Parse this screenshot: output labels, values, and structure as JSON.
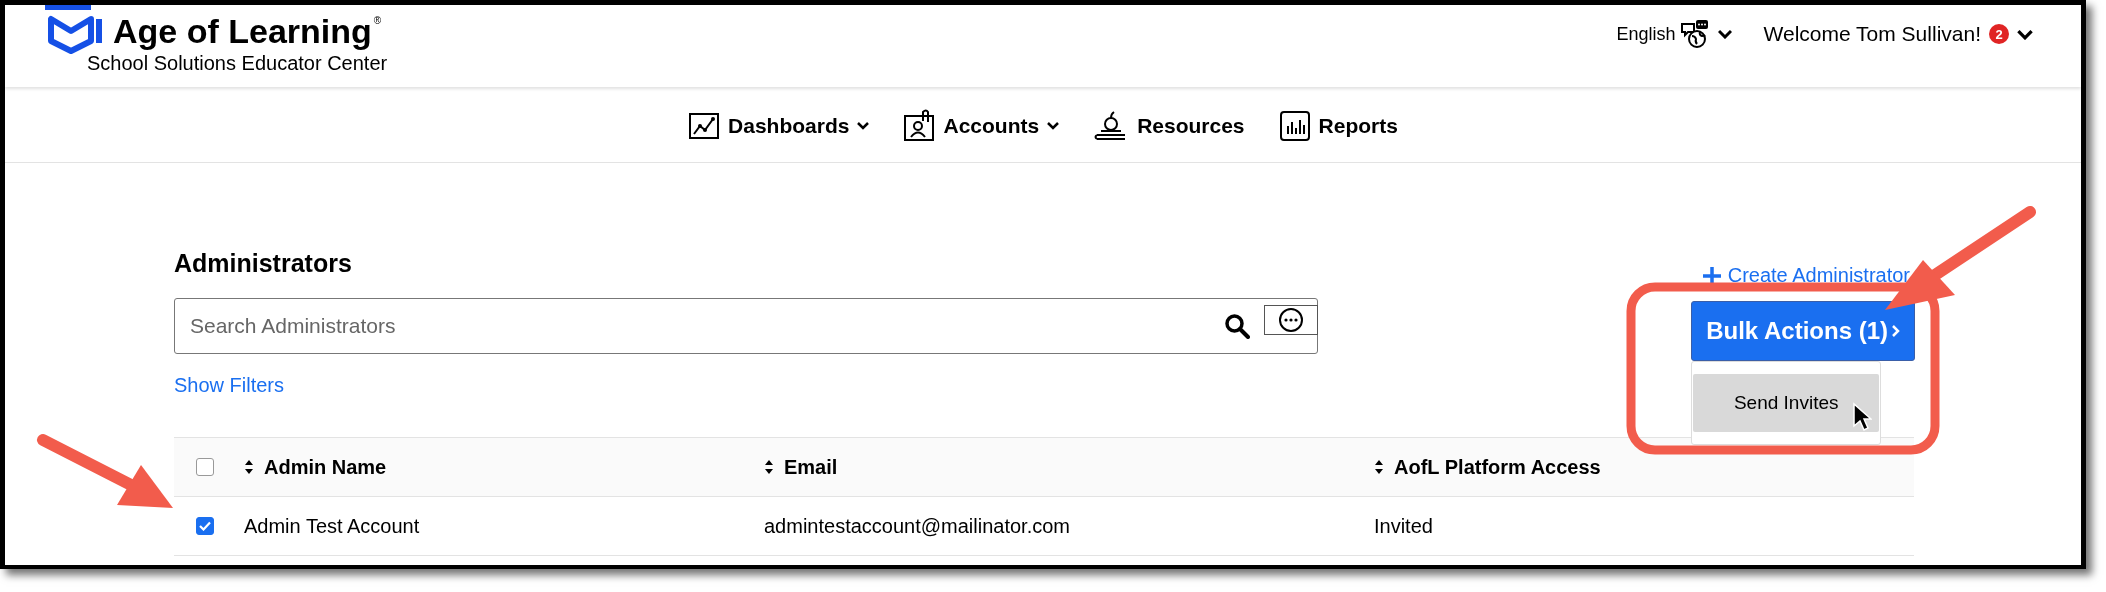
{
  "header": {
    "brand": "Age of Learning",
    "registered": "®",
    "subtitle": "School Solutions Educator Center",
    "language": "English",
    "welcome": "Welcome Tom Sullivan!",
    "notification_count": "2"
  },
  "nav": [
    {
      "label": "Dashboards",
      "kind": "chart",
      "dropdown": true
    },
    {
      "label": "Accounts",
      "kind": "badge",
      "dropdown": true
    },
    {
      "label": "Resources",
      "kind": "book",
      "dropdown": false
    },
    {
      "label": "Reports",
      "kind": "bars",
      "dropdown": false
    }
  ],
  "page": {
    "title": "Administrators",
    "search_placeholder": "Search Administrators",
    "filters_link": "Show Filters",
    "create_link": "Create Administrator"
  },
  "bulk_actions": {
    "label": "Bulk Actions (1)",
    "expanded": true,
    "menu": [
      {
        "label": "Send Invites",
        "hovered": true
      }
    ]
  },
  "table": {
    "all_checked": false,
    "columns": [
      {
        "label": "Admin Name"
      },
      {
        "label": "Email"
      },
      {
        "label": "AofL Platform Access"
      }
    ],
    "rows": [
      {
        "checked": true,
        "cells": [
          "Admin Test Account",
          "admintestaccount@mailinator.com",
          "Invited"
        ]
      }
    ]
  }
}
